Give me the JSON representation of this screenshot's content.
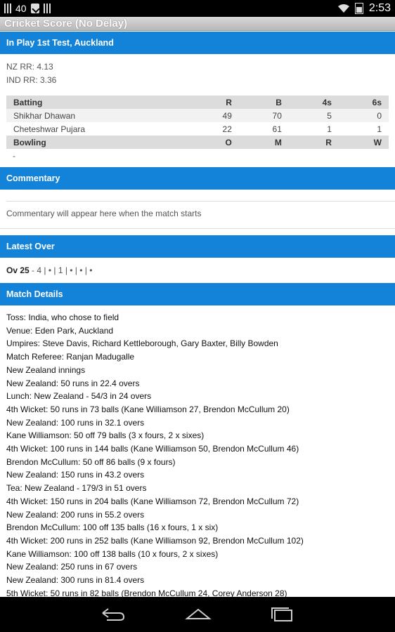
{
  "status_bar": {
    "signal_count": "40",
    "time": "2:53"
  },
  "app": {
    "title": "Cricket Score (No Delay)"
  },
  "in_play": {
    "header": "In Play 1st Test, Auckland",
    "nz_rr": "NZ RR: 4.13",
    "ind_rr": "IND RR: 3.36",
    "batting_headers": [
      "Batting",
      "R",
      "B",
      "4s",
      "6s"
    ],
    "batsmen": [
      {
        "name": "Shikhar Dhawan",
        "r": "49",
        "b": "70",
        "fours": "5",
        "sixes": "0"
      },
      {
        "name": "Cheteshwar Pujara",
        "r": "22",
        "b": "61",
        "fours": "1",
        "sixes": "1"
      }
    ],
    "bowling_headers": [
      "Bowling",
      "O",
      "M",
      "R",
      "W"
    ],
    "bowling_placeholder": "-"
  },
  "commentary": {
    "header": "Commentary",
    "text": "Commentary will appear here when the match starts"
  },
  "latest_over": {
    "header": "Latest Over",
    "label": "Ov 25",
    "balls": " - 4 | • | 1 | • | • | •"
  },
  "match_details": {
    "header": "Match Details",
    "lines": [
      "Toss: India, who chose to field",
      "Venue: Eden Park, Auckland",
      "Umpires: Steve Davis, Richard Kettleborough, Gary Baxter, Billy Bowden",
      "Match Referee: Ranjan Madugalle",
      "New Zealand innings",
      "New Zealand: 50 runs in 22.4 overs",
      "Lunch: New Zealand - 54/3 in 24 overs",
      "4th Wicket: 50 runs in 73 balls (Kane Williamson 27, Brendon McCullum 20)",
      "New Zealand: 100 runs in 32.1 overs",
      "Kane Williamson: 50 off 79 balls (3 x fours, 2 x sixes)",
      "4th Wicket: 100 runs in 144 balls (Kane Williamson 50, Brendon McCullum 46)",
      "Brendon McCullum: 50 off 86 balls (9 x fours)",
      "New Zealand: 150 runs in 43.2 overs",
      "Tea: New Zealand - 179/3 in 51 overs",
      "4th Wicket: 150 runs in 204 balls (Kane Williamson 72, Brendon McCullum 72)",
      "New Zealand: 200 runs in 55.2 overs",
      "Brendon McCullum: 100 off 135 balls (16 x fours, 1 x six)",
      "4th Wicket: 200 runs in 252 balls (Kane Williamson 92, Brendon McCullum 102)",
      "Kane Williamson: 100 off 138 balls (10 x fours, 2 x sixes)",
      "New Zealand: 250 runs in 67 overs",
      "New Zealand: 300 runs in 81.4 overs",
      "5th Wicket: 50 runs in 82 balls (Brendon McCullum 24, Corey Anderson 28)"
    ]
  },
  "icons": {
    "status_left": [
      "signal-bars-icon",
      "clipboard-check-icon",
      "signal-bars-icon"
    ],
    "status_right": [
      "wifi-icon",
      "battery-icon"
    ],
    "nav": [
      "back-icon",
      "home-icon",
      "recent-apps-icon"
    ]
  },
  "colors": {
    "section_header": "#1283d8",
    "status_bar": "#000000",
    "table_header": "#dcdcdc"
  }
}
